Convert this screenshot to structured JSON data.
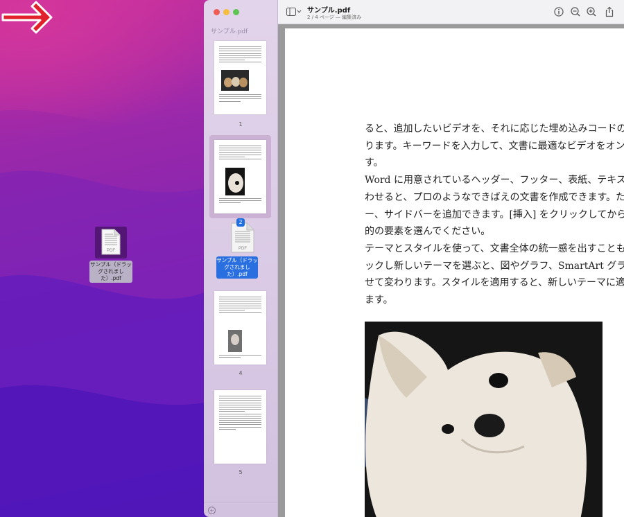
{
  "desktop": {
    "file": {
      "icon": "pdf-file-icon",
      "type_label": "PDF",
      "name": "サンプル（ドラッグされました）.pdf"
    }
  },
  "sidebar": {
    "title": "サンプル.pdf",
    "pages": [
      {
        "number": "1"
      },
      {
        "number": ""
      },
      {
        "number": "4"
      },
      {
        "number": "5"
      }
    ],
    "drag": {
      "badge": "2",
      "type_label": "PDF",
      "caption": "サンプル（ドラッグされました）.pdf"
    }
  },
  "toolbar": {
    "title": "サンプル.pdf",
    "subtitle": "2 / 4 ページ — 編集済み",
    "icons": [
      "sidebar-toggle-icon",
      "info-icon",
      "zoom-out-icon",
      "zoom-in-icon",
      "share-icon"
    ]
  },
  "document": {
    "lines": [
      "ると、追加したいビデオを、それに応じた埋め込みコードの貼",
      "ります。キーワードを入力して、文書に最適なビデオをオンラ",
      "す。",
      "Word に用意されているヘッダー、フッター、表紙、テキスト",
      "わせると、プロのようなできばえの文書を作成できます。たと",
      "ー、サイドバーを追加できます。[挿入] をクリックしてから",
      "的の要素を選んでください。",
      "テーマとスタイルを使って、文書全体の統一感を出すことも",
      "ックし新しいテーマを選ぶと、図やグラフ、SmartArt グラフ",
      "せて変わります。スタイルを適用すると、新しいテーマに適合",
      "ます。"
    ]
  },
  "colors": {
    "accent": "#1f6fe0",
    "arrow": "#e0202a"
  }
}
